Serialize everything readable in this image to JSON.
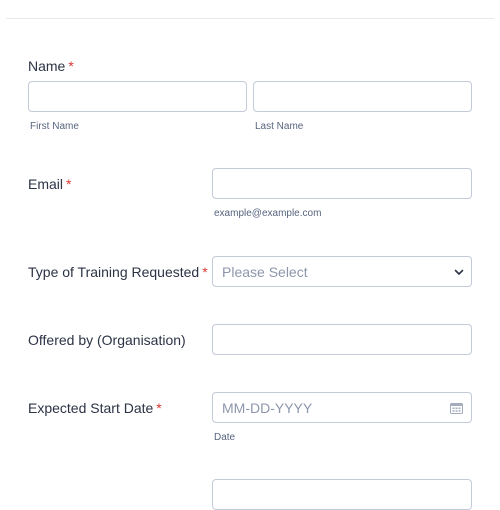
{
  "form": {
    "name": {
      "label": "Name",
      "required": "*",
      "first_sublabel": "First Name",
      "last_sublabel": "Last Name",
      "first_value": "",
      "last_value": ""
    },
    "email": {
      "label": "Email",
      "required": "*",
      "sublabel": "example@example.com",
      "value": ""
    },
    "training_type": {
      "label": "Type of Training Requested",
      "required": "*",
      "placeholder": "Please Select",
      "icon": "chevron-down-icon"
    },
    "offered_by": {
      "label": "Offered by (Organisation)",
      "value": ""
    },
    "start_date": {
      "label": "Expected Start Date",
      "required": "*",
      "placeholder": "MM-DD-YYYY",
      "sublabel": "Date",
      "icon": "calendar-icon"
    }
  },
  "colors": {
    "text": "#2c3345",
    "required": "#d93636",
    "border": "#c3cad8",
    "placeholder": "#8d96ab",
    "hint": "#57647e"
  }
}
